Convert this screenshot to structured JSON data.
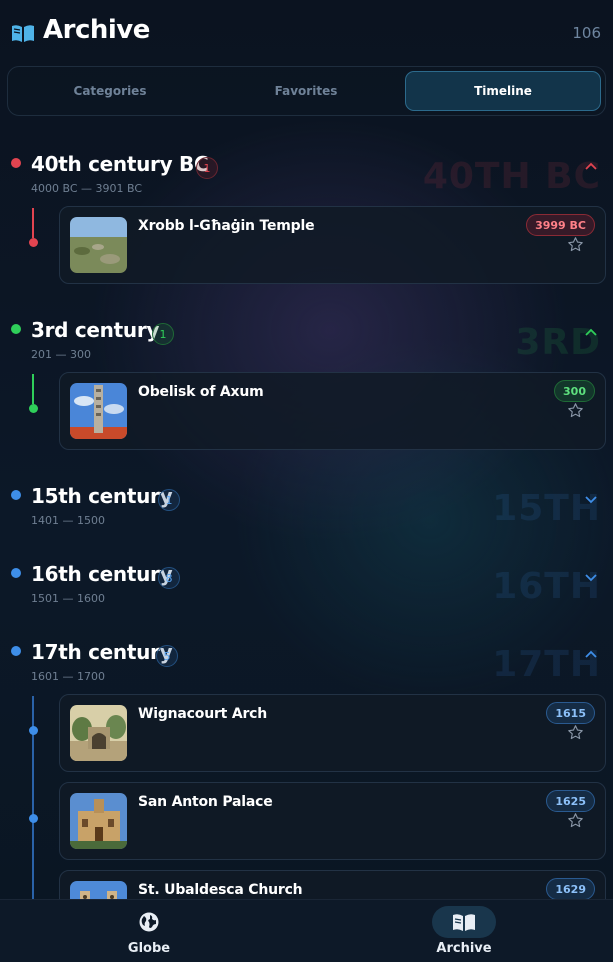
{
  "header": {
    "title": "Archive",
    "count": "106",
    "icon": "book-open-icon"
  },
  "tabs": [
    {
      "label": "Categories",
      "active": false
    },
    {
      "label": "Favorites",
      "active": false
    },
    {
      "label": "Timeline",
      "active": true
    }
  ],
  "colors": {
    "red": "#e24450",
    "green": "#2fcf5a",
    "blue": "#3e8ee8",
    "accent": "#2c6a8c"
  },
  "sections": [
    {
      "title": "40th century BC",
      "badge": "1",
      "range": "4000 BC — 3901 BC",
      "ghost": "40TH BC",
      "expanded": true,
      "items": [
        {
          "title": "Xrobb l-Għaġin Temple",
          "year": "3999 BC",
          "favorite": false
        }
      ]
    },
    {
      "title": "3rd century",
      "badge": "1",
      "range": "201 — 300",
      "ghost": "3RD",
      "expanded": true,
      "items": [
        {
          "title": "Obelisk of Axum",
          "year": "300",
          "favorite": false
        }
      ]
    },
    {
      "title": "15th century",
      "badge": "1",
      "range": "1401 — 1500",
      "ghost": "15TH",
      "expanded": false,
      "items": []
    },
    {
      "title": "16th century",
      "badge": "8",
      "range": "1501 — 1600",
      "ghost": "16TH",
      "expanded": false,
      "items": []
    },
    {
      "title": "17th century",
      "badge": "5",
      "range": "1601 — 1700",
      "ghost": "17TH",
      "expanded": true,
      "items": [
        {
          "title": "Wignacourt Arch",
          "year": "1615",
          "favorite": false
        },
        {
          "title": "San Anton Palace",
          "year": "1625",
          "favorite": false
        },
        {
          "title": "St. Ubaldesca Church",
          "year": "1629",
          "favorite": false
        }
      ]
    }
  ],
  "bottom_nav": [
    {
      "label": "Globe",
      "icon": "globe-icon",
      "active": false
    },
    {
      "label": "Archive",
      "icon": "book-open-icon",
      "active": true
    }
  ]
}
